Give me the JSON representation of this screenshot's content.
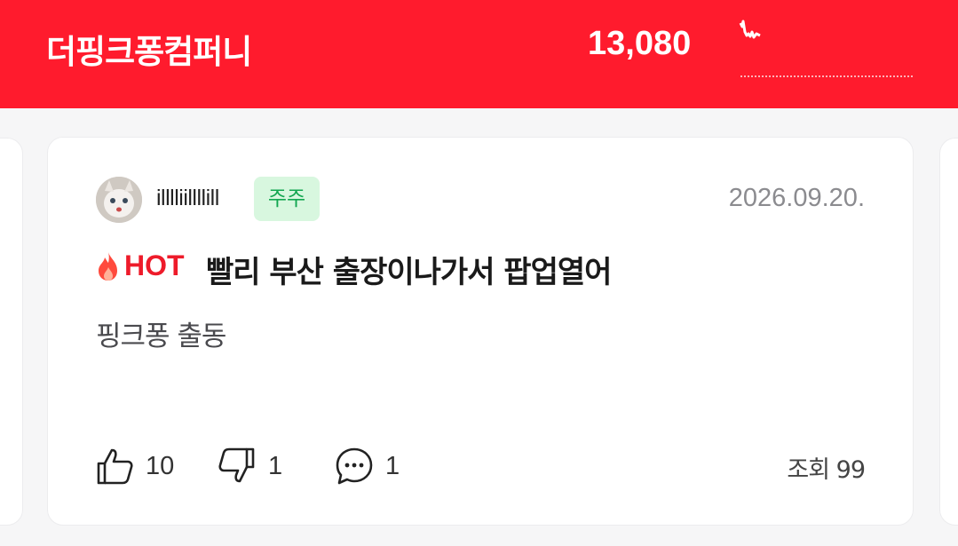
{
  "header": {
    "company_name": "더핑크퐁컴퍼니",
    "price": "13,080",
    "bg_color": "#ff1b2d"
  },
  "post": {
    "author": "illlliillllill",
    "badge": "주주",
    "date": "2026.09.20.",
    "hot_label": "HOT",
    "title": "빨리 부산 출장이나가서 팝업열어",
    "body": "핑크퐁 출동",
    "likes": "10",
    "dislikes": "1",
    "comments": "1",
    "views_label": "조회 99"
  },
  "icons": [
    "avatar",
    "fire-icon",
    "thumbs-up-icon",
    "thumbs-down-icon",
    "comment-icon"
  ],
  "colors": {
    "accent": "#ff1b2d",
    "hot": "#ee1b2a",
    "badge_bg": "#d8f7df",
    "badge_text": "#12a650"
  }
}
